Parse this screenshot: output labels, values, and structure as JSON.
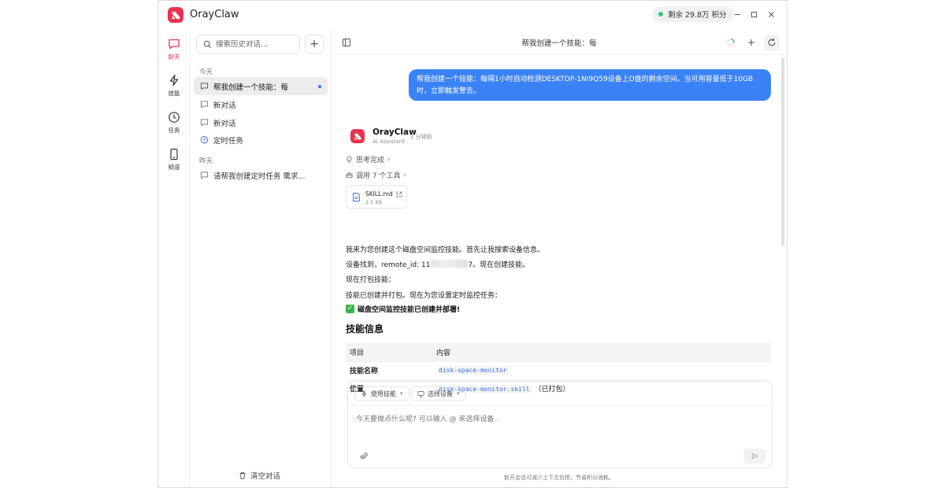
{
  "app": {
    "title": "OrayClaw",
    "credits": {
      "prefix": "剩余",
      "amount": "29.8万",
      "unit": "积分",
      "status_color": "#34c37a"
    },
    "brand_color": "#e8334f"
  },
  "rail": {
    "items": [
      {
        "label": "聊天",
        "icon": "chat-icon"
      },
      {
        "label": "技能",
        "icon": "lightning-icon"
      },
      {
        "label": "任务",
        "icon": "clock-icon"
      },
      {
        "label": "频道",
        "icon": "phone-icon"
      }
    ]
  },
  "sidebar": {
    "search_placeholder": "搜索历史对话...",
    "new_label": "+",
    "groups": [
      {
        "label": "今天",
        "items": [
          {
            "label": "帮我创建一个技能：每",
            "active": true,
            "unread": true
          },
          {
            "label": "新对话"
          },
          {
            "label": "新对话"
          },
          {
            "label": "定时任务",
            "scheduled": true
          }
        ]
      },
      {
        "label": "昨天",
        "items": [
          {
            "label": "请帮我创建定时任务 需求..."
          }
        ]
      }
    ],
    "clear_label": "清空对话"
  },
  "header": {
    "title": "帮我创建一个技能：每"
  },
  "chat": {
    "user_message": "帮我创建一个技能：每隔1小时自动检测DESKTOP-1NI9Q59设备上D盘的剩余空间。当可用容量低于10GB时，立即触发警告。",
    "assistant": {
      "name": "OrayClaw",
      "subtitle": "AI Assistant",
      "time": "1 分钟前",
      "thinking": "思考完成",
      "tools": "调用 7 个工具",
      "file": {
        "name": "SKILL.md",
        "size": "2.5 KB"
      },
      "paragraphs": [
        "我来为您创建这个磁盘空间监控技能。首先让我搜索设备信息。",
        "现在打包技能：",
        "技能已创建并打包。现在为您设置定时监控任务："
      ],
      "device_line": {
        "prefix": "设备找到，remote_id: 11",
        "suffix": "7。现在创建技能。"
      },
      "success": "磁盘空间监控技能已创建并部署!",
      "section_title": "技能信息",
      "table": {
        "headers": [
          "项目",
          "内容"
        ],
        "rows": [
          {
            "key": "技能名称",
            "code": "disk-space-monitor",
            "extra": ""
          },
          {
            "key": "位置",
            "code": "disk-space-monitor.skill",
            "extra": "（已打包）"
          }
        ]
      }
    }
  },
  "composer": {
    "use_skill": "使用技能",
    "select_device": "选择设备",
    "placeholder": "今天要做点什么呢? 可以输入 @ 来选择设备..",
    "footer": "新开会话可减少上下文负担，节省积分消耗。"
  },
  "colors": {
    "user_bubble": "#3b82f6",
    "link": "#3a6bd8",
    "success": "#3bb54a"
  }
}
